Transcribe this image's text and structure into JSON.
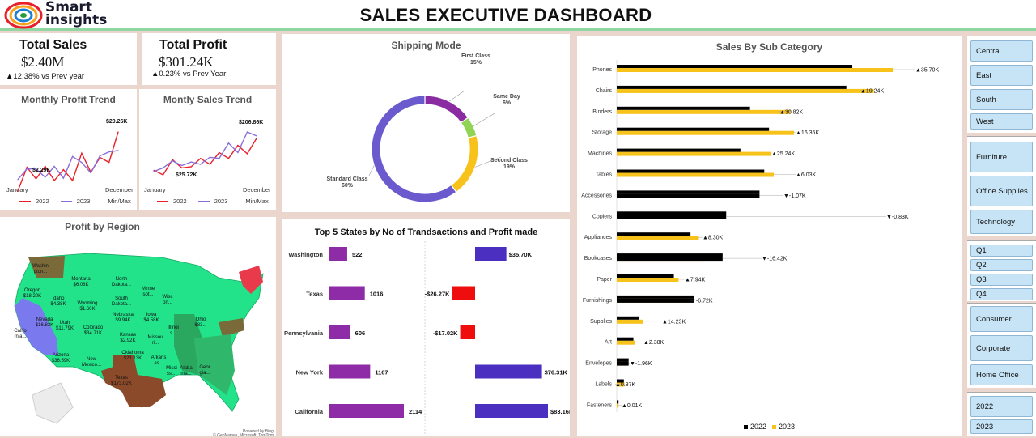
{
  "header": {
    "title": "SALES EXECUTIVE DASHBOARD",
    "logo_line1": "Smart",
    "logo_line2": "insights"
  },
  "kpis": {
    "total_sales": {
      "title": "Total Sales",
      "value": "$2.40M",
      "change": "▲12.38% vs Prev year"
    },
    "total_profit": {
      "title": "Total Profit",
      "value": "$301.24K",
      "change": "▲0.23% vs Prev Year"
    }
  },
  "monthly_profit": {
    "title": "Monthly Profit Trend",
    "max_label": "$20.26K",
    "min_label": "$2.29K",
    "x_start": "January",
    "x_end": "December",
    "legend": [
      "2022",
      "2023",
      "Min/Max"
    ]
  },
  "monthly_sales": {
    "title": "Montly Sales Trend",
    "max_label": "$206.86K",
    "min_label": "$25.72K",
    "x_start": "January",
    "x_end": "December",
    "legend": [
      "2022",
      "2023",
      "Min/Max"
    ]
  },
  "shipping": {
    "title": "Shipping Mode"
  },
  "region_map": {
    "title": "Profit by Region",
    "attribution_1": "Powered by Bing",
    "attribution_2": "© GeoNames, Microsoft, TomTom",
    "labels": [
      {
        "text": "Washin\ngton...",
        "key": "wa"
      },
      {
        "text": "Oregon\n$18.20K",
        "key": "or"
      },
      {
        "text": "Idaho\n$4.38K",
        "key": "id"
      },
      {
        "text": "Montana\n$6.08K",
        "key": "mt"
      },
      {
        "text": "North\nDakota...",
        "key": "nd"
      },
      {
        "text": "South\nDakota...",
        "key": "sd"
      },
      {
        "text": "Minne\nsot...",
        "key": "mn"
      },
      {
        "text": "Wisc\non...",
        "key": "wi"
      },
      {
        "text": "Wyoming\n$1.60K",
        "key": "wy"
      },
      {
        "text": "Nevada\n$16.83K",
        "key": "nv"
      },
      {
        "text": "Utah\n$11.79K",
        "key": "ut"
      },
      {
        "text": "Colorado\n$34.71K",
        "key": "co"
      },
      {
        "text": "Nebraska\n$9.94K",
        "key": "ne"
      },
      {
        "text": "Iowa\n$4.58K",
        "key": "ia"
      },
      {
        "text": "Califo\nrnia...",
        "key": "ca"
      },
      {
        "text": "Kansas\n$2.92K",
        "key": "ks"
      },
      {
        "text": "Missou\nri...",
        "key": "mo"
      },
      {
        "text": "Illinoi\ns...",
        "key": "il"
      },
      {
        "text": "Ohio\n$83...",
        "key": "oh"
      },
      {
        "text": "Arizona\n$36.59K",
        "key": "az"
      },
      {
        "text": "New\nMexico...",
        "key": "nm"
      },
      {
        "text": "Oklahoma\n$21.13K",
        "key": "ok"
      },
      {
        "text": "Arkans\nas...",
        "key": "ar"
      },
      {
        "text": "Texas\n$173.02K",
        "key": "tx"
      },
      {
        "text": "Missi\nssi...",
        "key": "ms"
      },
      {
        "text": "Alaba\nma...",
        "key": "al"
      },
      {
        "text": "Geor\ngia...",
        "key": "ga"
      }
    ]
  },
  "top_states": {
    "title": "Top 5 States by No of Trandsactions and  Profit made"
  },
  "subcat": {
    "title": "Sales By Sub Category",
    "legend": [
      "2022",
      "2023"
    ]
  },
  "slicers": {
    "region": [
      "Central",
      "East",
      "South",
      "West"
    ],
    "category": [
      "Furniture",
      "Office Supplies",
      "Technology"
    ],
    "quarter": [
      "Q1",
      "Q2",
      "Q3",
      "Q4"
    ],
    "segment": [
      "Consumer",
      "Corporate",
      "Home Office"
    ],
    "year": [
      "2022",
      "2023"
    ]
  },
  "colors": {
    "c2022": "#e8202a",
    "c2023": "#8b6fd9",
    "standard": "#6a5acd",
    "first": "#8a2ba2",
    "same": "#8fd454",
    "second": "#f7c21a",
    "bar22": "#000000",
    "bar23": "#f7c21a",
    "txn": "#8e2ca8",
    "profit_pos": "#4a2fc0",
    "profit_neg": "#ee0e0e",
    "map_base": "#22e28a"
  },
  "chart_data": [
    {
      "type": "line",
      "title": "Monthly Profit Trend",
      "x": [
        "Jan",
        "Feb",
        "Mar",
        "Apr",
        "May",
        "Jun",
        "Jul",
        "Aug",
        "Sep",
        "Oct",
        "Nov",
        "Dec"
      ],
      "series": [
        {
          "name": "2022",
          "values": [
            2.29,
            9.5,
            6.0,
            9.8,
            5.5,
            8.8,
            5.5,
            13.8,
            8.0,
            12.5,
            11.0,
            20.26
          ]
        },
        {
          "name": "2023",
          "values": [
            5.8,
            9.0,
            9.0,
            6.5,
            9.8,
            6.2,
            12.8,
            11.0,
            7.8,
            13.0,
            14.2,
            14.6
          ]
        }
      ],
      "annotations": [
        "$20.26K",
        "$2.29K"
      ]
    },
    {
      "type": "line",
      "title": "Montly Sales Trend",
      "x": [
        "Jan",
        "Feb",
        "Mar",
        "Apr",
        "May",
        "Jun",
        "Jul",
        "Aug",
        "Sep",
        "Oct",
        "Nov",
        "Dec"
      ],
      "series": [
        {
          "name": "2022",
          "values": [
            45,
            25.72,
            90,
            55,
            60,
            95,
            70,
            120,
            95,
            150,
            115,
            180
          ]
        },
        {
          "name": "2023",
          "values": [
            40,
            55,
            85,
            65,
            80,
            70,
            100,
            95,
            160,
            120,
            206.86,
            190
          ]
        }
      ],
      "annotations": [
        "$206.86K",
        "$25.72K"
      ]
    },
    {
      "type": "pie",
      "title": "Shipping Mode",
      "categories": [
        "First Class",
        "Same Day",
        "Second Class",
        "Standard Class"
      ],
      "values": [
        15,
        6,
        19,
        60
      ],
      "labels": [
        "15%",
        "6%",
        "19%",
        "60%"
      ]
    },
    {
      "type": "bar",
      "title": "Top 5 States by No of Trandsactions and  Profit made",
      "categories": [
        "Washington",
        "Texas",
        "Pennsylvania",
        "New York",
        "California"
      ],
      "series": [
        {
          "values": [
            522,
            1016,
            606,
            1167,
            2114
          ],
          "labels": [
            "522",
            "1016",
            "606",
            "1167",
            "2114"
          ]
        },
        {
          "values": [
            35.7,
            -26.27,
            -17.02,
            76.31,
            83.16
          ],
          "labels": [
            "$35.70K",
            "-$26.27K",
            "-$17.02K",
            "$76.31K",
            "$83.16K"
          ]
        }
      ]
    },
    {
      "type": "bar",
      "title": "Sales By Sub Category",
      "categories": [
        "Phones",
        "Chairs",
        "Binders",
        "Storage",
        "Machines",
        "Tables",
        "Accessories",
        "Copiers",
        "Appliances",
        "Bookcases",
        "Paper",
        "Furnishings",
        "Supplies",
        "Art",
        "Envelopes",
        "Labels",
        "Fasteners"
      ],
      "series": [
        {
          "name": "2022",
          "values": [
            198,
            193,
            112,
            128,
            104,
            124,
            120,
            92,
            62,
            89,
            48,
            65,
            19,
            14,
            10,
            6,
            1.5
          ]
        },
        {
          "name": "2023",
          "values": [
            232,
            216,
            146,
            149,
            130,
            132,
            118,
            91,
            69,
            74,
            52,
            61,
            22,
            15,
            9,
            6.5,
            1.5
          ]
        }
      ],
      "change_labels": [
        "▲35.70K",
        "▲19.24K",
        "▲30.82K",
        "▲16.36K",
        "▲25.24K",
        "▲6.03K",
        "▼-1.07K",
        "▼-0.83K",
        "▲8.30K",
        "▼-16.42K",
        "▲7.94K",
        "▼-6.72K",
        "▲14.23K",
        "▲2.38K",
        "▼-1.96K",
        "▲0.87K",
        "▲0.01K"
      ]
    }
  ]
}
